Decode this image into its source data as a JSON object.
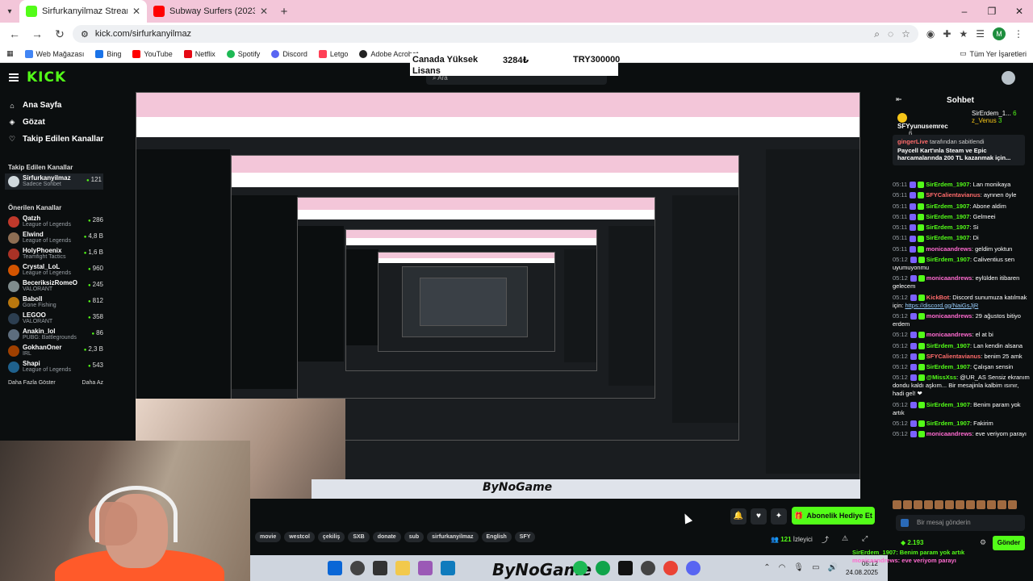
{
  "browser": {
    "tabs": [
      {
        "title": "Sirfurkanyilmaz Stream - Watch",
        "active": true
      },
      {
        "title": "Subway Surfers (2023) - Gamep",
        "active": false
      }
    ],
    "url": "kick.com/sirfurkanyilmaz",
    "bookmarks": [
      "Web Mağazası",
      "Bing",
      "YouTube",
      "Netflix",
      "Spotify",
      "Discord",
      "Letgo",
      "Adobe Acrobat"
    ],
    "bookmarks_right": "Tüm Yer İşaretleri",
    "profile_initial": "M"
  },
  "overlay_price": {
    "name_line1": "Canada Yüksek",
    "name_line2": "Lisans",
    "price_try": "3284₺",
    "price_code": "TRY300000"
  },
  "kick_header": {
    "logo": "KICK",
    "search_placeholder": "Ara"
  },
  "sidebar": {
    "nav": [
      {
        "label": "Ana Sayfa",
        "icon": "home-icon"
      },
      {
        "label": "Gözat",
        "icon": "compass-icon"
      },
      {
        "label": "Takip Edilen Kanallar",
        "icon": "heart-icon"
      }
    ],
    "followed_heading": "Takip Edilen Kanallar",
    "followed": [
      {
        "name": "Sirfurkanyilmaz",
        "sub": "Sadece Sohbet",
        "viewers": "121",
        "color": "#cfd8dc"
      }
    ],
    "recommended_heading": "Önerilen Kanallar",
    "recommended": [
      {
        "name": "Qatzh",
        "sub": "League of Legends",
        "viewers": "286",
        "color": "#c0392b"
      },
      {
        "name": "Elwind",
        "sub": "League of Legends",
        "viewers": "4,8 B",
        "color": "#8e6e53"
      },
      {
        "name": "HolyPhoenix",
        "sub": "Teamfight Tactics",
        "viewers": "1,6 B",
        "color": "#a93226"
      },
      {
        "name": "Crystal_LoL",
        "sub": "League of Legends",
        "viewers": "960",
        "color": "#d35400"
      },
      {
        "name": "BeceriksizRomeO",
        "sub": "VALORANT",
        "viewers": "245",
        "color": "#7f8c8d"
      },
      {
        "name": "Baboll",
        "sub": "Gone Fishing",
        "viewers": "812",
        "color": "#b9770e"
      },
      {
        "name": "LEGOO",
        "sub": "VALORANT",
        "viewers": "358",
        "color": "#2c3e50"
      },
      {
        "name": "Anakin_lol",
        "sub": "PUBG: Battlegrounds",
        "viewers": "86",
        "color": "#5d6d7e"
      },
      {
        "name": "GokhanOner",
        "sub": "IRL",
        "viewers": "2,3 B",
        "color": "#a04000"
      },
      {
        "name": "Shapi",
        "sub": "League of Legends",
        "viewers": "543",
        "color": "#1f618d"
      }
    ],
    "show_more": "Daha Fazla Göster",
    "show_less": "Daha Az"
  },
  "stream": {
    "gift_button": "Abonelik Hediye Et",
    "tags": [
      "movie",
      "westcol",
      "çekiliş",
      "SXB",
      "donate",
      "sub",
      "sirfurkanyilmaz",
      "English",
      "SFY"
    ],
    "viewer_count": "121",
    "viewer_label": "İzleyici",
    "bynogame": "ByNoGame"
  },
  "taskbar": {
    "time": "05:12",
    "date": "24.08.2025"
  },
  "chat": {
    "title": "Sohbet",
    "leaders": [
      {
        "name": "SFYyunusemrec",
        "count": "6"
      },
      {
        "name": "SirErdem_1...",
        "count": "6",
        "second": "z_Venus",
        "second_count": "3"
      }
    ],
    "pinned_by": "gingerLive",
    "pinned_by_suffix": "tarafından sabitlendi",
    "pinned_message": "Paycell Kart'ınla Steam ve Epic harcamalarında 200 TL kazanmak için...",
    "messages": [
      {
        "time": "05:11",
        "user": "SirErdem_1907",
        "text": "Lan monikaya",
        "color": "#53fc18"
      },
      {
        "time": "05:11",
        "user": "SFYCalientavianus",
        "text": "aynnen öyle",
        "color": "#ff6b6b"
      },
      {
        "time": "05:11",
        "user": "SirErdem_1907",
        "text": "Abone aldim",
        "color": "#53fc18"
      },
      {
        "time": "05:11",
        "user": "SirErdem_1907",
        "text": "Gelmeei",
        "color": "#53fc18"
      },
      {
        "time": "05:11",
        "user": "SirErdem_1907",
        "text": "Si",
        "color": "#53fc18"
      },
      {
        "time": "05:11",
        "user": "SirErdem_1907",
        "text": "Di",
        "color": "#53fc18"
      },
      {
        "time": "05:11",
        "user": "monicaandrews",
        "text": "geldim yoktun",
        "color": "#ff6bd0"
      },
      {
        "time": "05:12",
        "user": "SirErdem_1907",
        "text": "Caliventius sen uyumuyonmu",
        "color": "#53fc18"
      },
      {
        "time": "05:12",
        "user": "monicaandrews",
        "text": "eylülden itibaren gelecem",
        "color": "#ff6bd0"
      },
      {
        "time": "05:12",
        "user": "KickBot",
        "text": "Discord sunumuza katılmak için:",
        "link": "https://discord.gg/NaiGsJjR",
        "color": "#ff6b6b"
      },
      {
        "time": "05:12",
        "user": "monicaandrews",
        "text": "29 ağustos bitiyo erdem",
        "color": "#ff6bd0"
      },
      {
        "time": "05:12",
        "user": "monicaandrews",
        "text": "el at bi",
        "color": "#ff6bd0"
      },
      {
        "time": "05:12",
        "user": "SirErdem_1907",
        "text": "Lan kendin alsana",
        "color": "#53fc18"
      },
      {
        "time": "05:12",
        "user": "SFYCalientavianus",
        "text": "benim 25 amk",
        "color": "#ff6b6b"
      },
      {
        "time": "05:12",
        "user": "SirErdem_1907",
        "text": "Çalışan sensin",
        "color": "#53fc18"
      },
      {
        "time": "05:12",
        "user": "@MissXss",
        "text": "@UR_AS Sensiz ekranım dondu kaldı aşkım... Bir mesajinla kalbim ısınır, hadi gel! ❤",
        "color": "#53fc18"
      },
      {
        "time": "05:12",
        "user": "SirErdem_1907",
        "text": "Benim param yok artık",
        "color": "#53fc18"
      },
      {
        "time": "05:12",
        "user": "SirErdem_1907",
        "text": "Fakirim",
        "color": "#53fc18"
      },
      {
        "time": "05:12",
        "user": "monicaandrews",
        "text": "eve veriyom parayı",
        "color": "#ff6bd0"
      }
    ],
    "input_placeholder": "Bir mesaj gönderin",
    "points": "2.193",
    "send_label": "Gönder",
    "bottom_line1": "SirErdem_1907: Benim param yok artık",
    "bottom_line2": "monicaandrews: eve veriyom parayı"
  }
}
